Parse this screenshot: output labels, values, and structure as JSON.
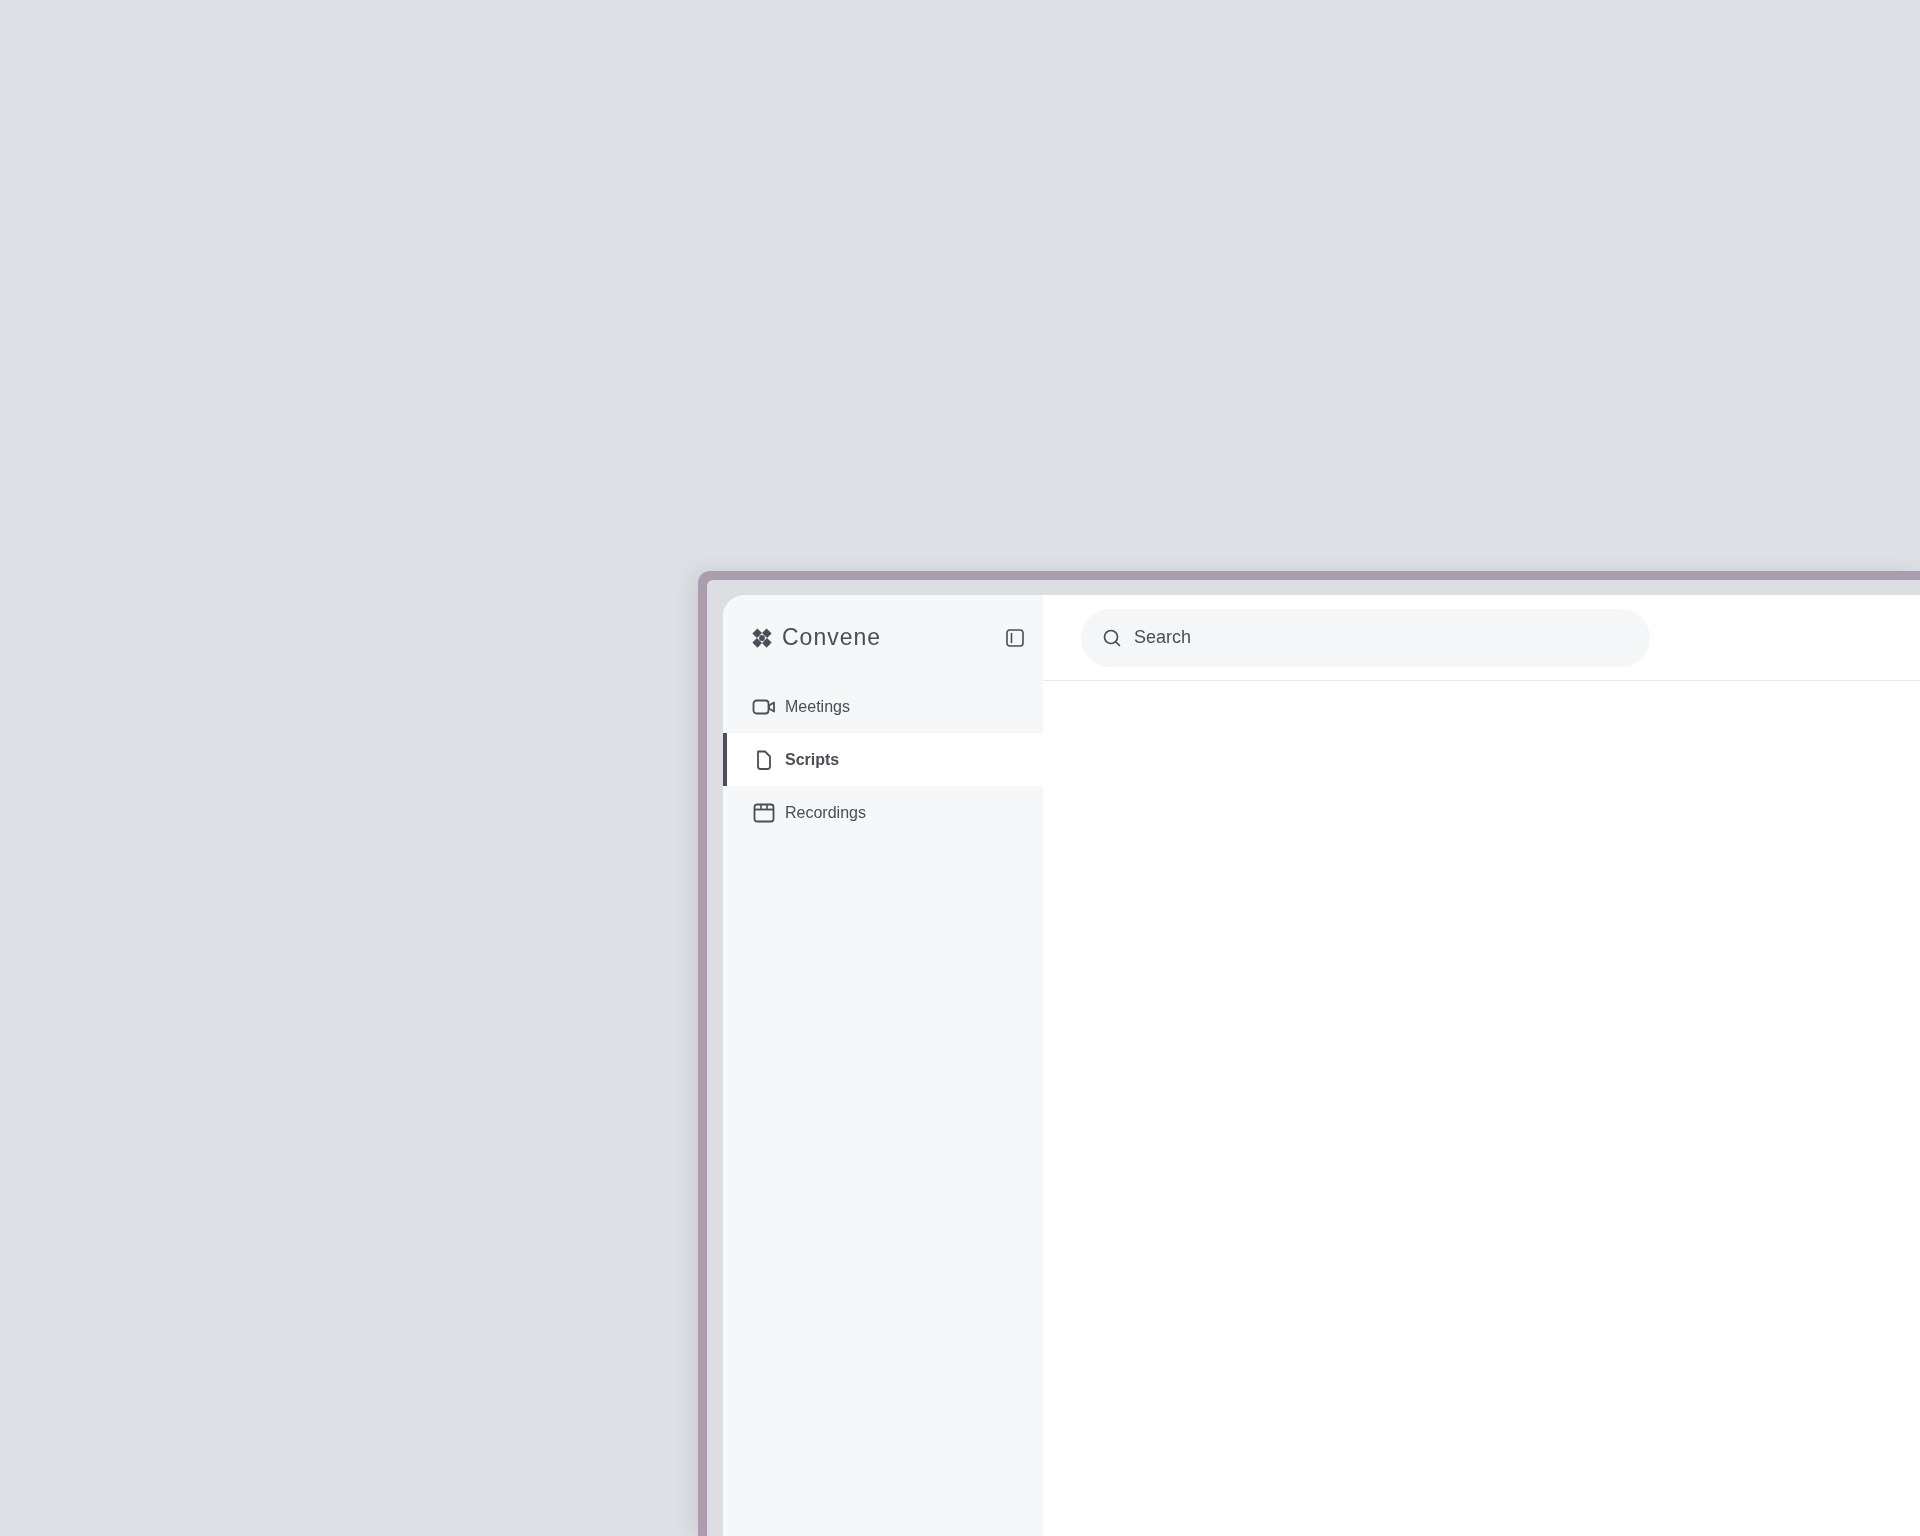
{
  "brand": {
    "name": "Convene"
  },
  "sidebar": {
    "items": [
      {
        "label": "Meetings",
        "selected": false
      },
      {
        "label": "Scripts",
        "selected": true
      },
      {
        "label": "Recordings",
        "selected": false
      }
    ]
  },
  "search": {
    "placeholder": "Search"
  }
}
